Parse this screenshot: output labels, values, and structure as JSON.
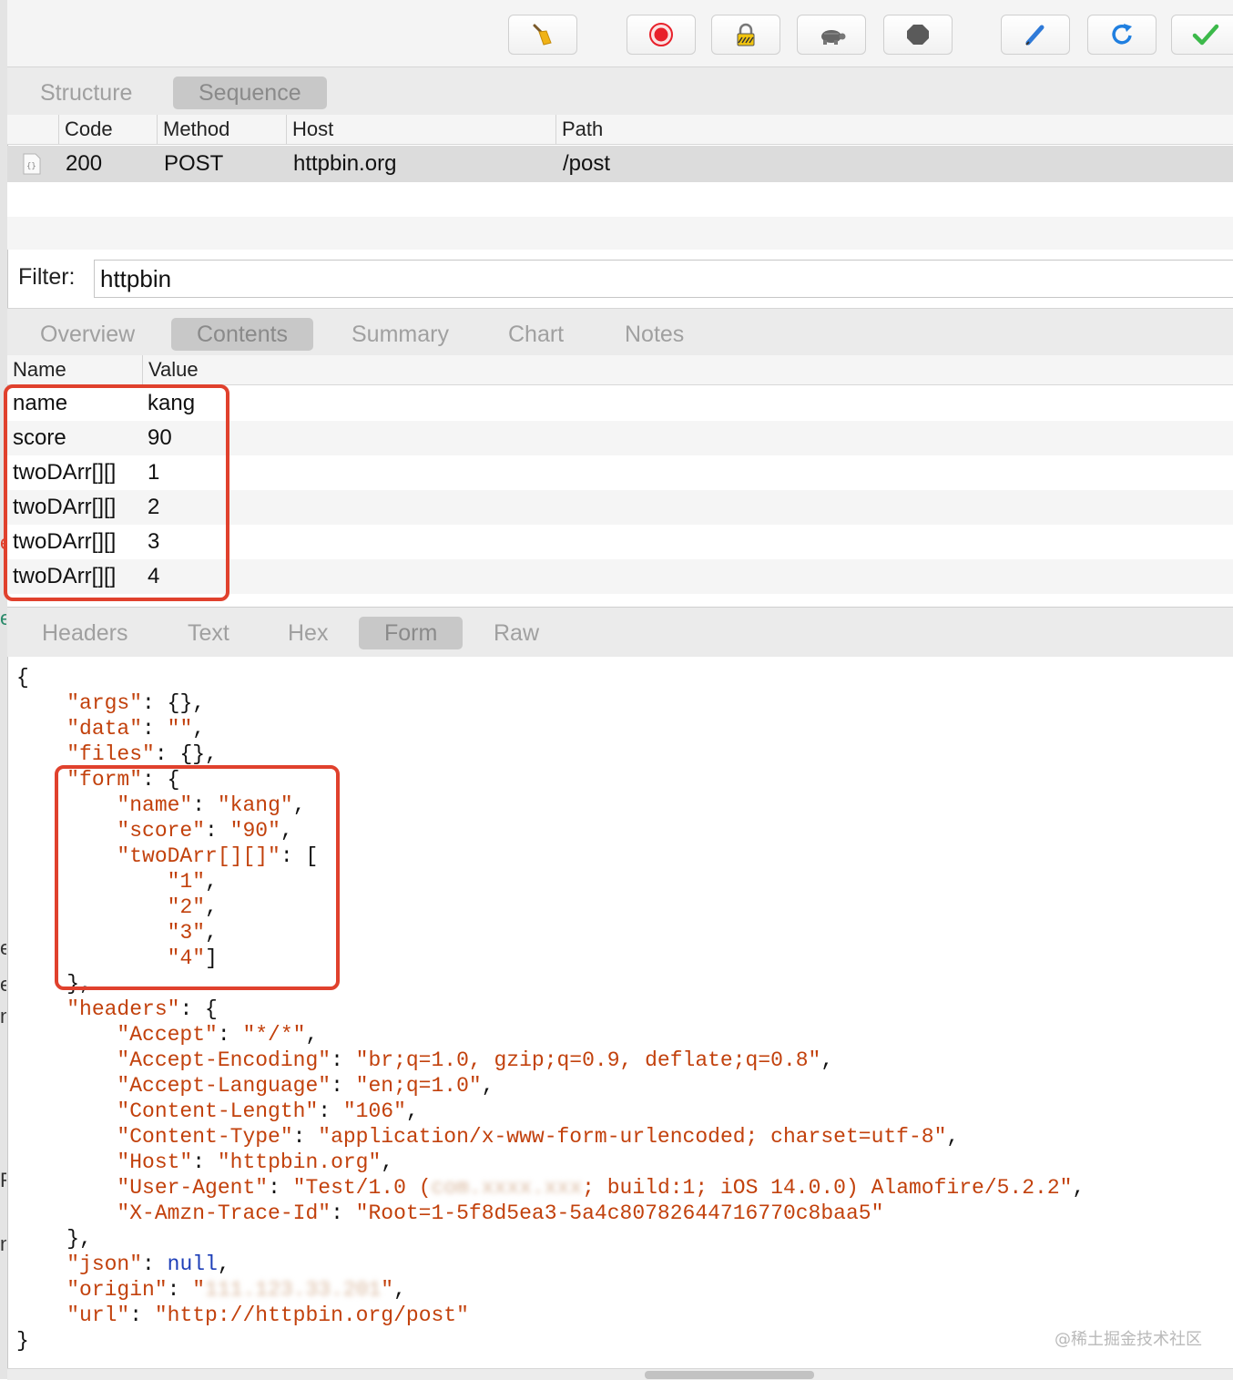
{
  "toolbar": {
    "buttons": [
      {
        "icon": "broom-icon"
      },
      {
        "icon": "record-icon"
      },
      {
        "icon": "lock-icon"
      },
      {
        "icon": "turtle-icon"
      },
      {
        "icon": "stop-icon"
      },
      {
        "icon": "pen-icon"
      },
      {
        "icon": "refresh-icon"
      },
      {
        "icon": "checkmark-icon"
      }
    ],
    "colors": {
      "record": "#e8202a",
      "refresh": "#1f7fe0",
      "check": "#3cb94a",
      "pen": "#2f7ad8",
      "broom": "#f0b216"
    }
  },
  "view_tabs": [
    {
      "label": "Structure",
      "active": false
    },
    {
      "label": "Sequence",
      "active": true
    }
  ],
  "request_table": {
    "columns": [
      "Code",
      "Method",
      "Host",
      "Path"
    ],
    "rows": [
      {
        "code": "200",
        "method": "POST",
        "host": "httpbin.org",
        "path": "/post"
      }
    ]
  },
  "filter": {
    "label": "Filter:",
    "value": "httpbin"
  },
  "detail_tabs": [
    {
      "label": "Overview",
      "active": false
    },
    {
      "label": "Contents",
      "active": true
    },
    {
      "label": "Summary",
      "active": false
    },
    {
      "label": "Chart",
      "active": false
    },
    {
      "label": "Notes",
      "active": false
    }
  ],
  "params_table": {
    "columns": [
      "Name",
      "Value"
    ],
    "rows": [
      {
        "name": "name",
        "value": "kang"
      },
      {
        "name": "score",
        "value": "90"
      },
      {
        "name": "twoDArr[][]",
        "value": "1"
      },
      {
        "name": "twoDArr[][]",
        "value": "2"
      },
      {
        "name": "twoDArr[][]",
        "value": "3"
      },
      {
        "name": "twoDArr[][]",
        "value": "4"
      }
    ]
  },
  "body_tabs": [
    {
      "label": "Headers",
      "active": false
    },
    {
      "label": "Text",
      "active": false
    },
    {
      "label": "Hex",
      "active": false
    },
    {
      "label": "Form",
      "active": true
    },
    {
      "label": "Raw",
      "active": false
    }
  ],
  "json_lines": [
    [
      {
        "t": "p",
        "v": "{"
      }
    ],
    [
      {
        "t": "p",
        "v": "    "
      },
      {
        "t": "k",
        "v": "\"args\""
      },
      {
        "t": "p",
        "v": ": {},"
      }
    ],
    [
      {
        "t": "p",
        "v": "    "
      },
      {
        "t": "k",
        "v": "\"data\""
      },
      {
        "t": "p",
        "v": ": "
      },
      {
        "t": "s",
        "v": "\"\""
      },
      {
        "t": "p",
        "v": ","
      }
    ],
    [
      {
        "t": "p",
        "v": "    "
      },
      {
        "t": "k",
        "v": "\"files\""
      },
      {
        "t": "p",
        "v": ": {},"
      }
    ],
    [
      {
        "t": "p",
        "v": "    "
      },
      {
        "t": "k",
        "v": "\"form\""
      },
      {
        "t": "p",
        "v": ": {"
      }
    ],
    [
      {
        "t": "p",
        "v": "        "
      },
      {
        "t": "k",
        "v": "\"name\""
      },
      {
        "t": "p",
        "v": ": "
      },
      {
        "t": "s",
        "v": "\"kang\""
      },
      {
        "t": "p",
        "v": ","
      }
    ],
    [
      {
        "t": "p",
        "v": "        "
      },
      {
        "t": "k",
        "v": "\"score\""
      },
      {
        "t": "p",
        "v": ": "
      },
      {
        "t": "s",
        "v": "\"90\""
      },
      {
        "t": "p",
        "v": ","
      }
    ],
    [
      {
        "t": "p",
        "v": "        "
      },
      {
        "t": "k",
        "v": "\"twoDArr[][]\""
      },
      {
        "t": "p",
        "v": ": ["
      }
    ],
    [
      {
        "t": "p",
        "v": "            "
      },
      {
        "t": "s",
        "v": "\"1\""
      },
      {
        "t": "p",
        "v": ","
      }
    ],
    [
      {
        "t": "p",
        "v": "            "
      },
      {
        "t": "s",
        "v": "\"2\""
      },
      {
        "t": "p",
        "v": ","
      }
    ],
    [
      {
        "t": "p",
        "v": "            "
      },
      {
        "t": "s",
        "v": "\"3\""
      },
      {
        "t": "p",
        "v": ","
      }
    ],
    [
      {
        "t": "p",
        "v": "            "
      },
      {
        "t": "s",
        "v": "\"4\""
      },
      {
        "t": "p",
        "v": "]"
      }
    ],
    [
      {
        "t": "p",
        "v": "    },"
      }
    ],
    [
      {
        "t": "p",
        "v": "    "
      },
      {
        "t": "k",
        "v": "\"headers\""
      },
      {
        "t": "p",
        "v": ": {"
      }
    ],
    [
      {
        "t": "p",
        "v": "        "
      },
      {
        "t": "k",
        "v": "\"Accept\""
      },
      {
        "t": "p",
        "v": ": "
      },
      {
        "t": "s",
        "v": "\"*/*\""
      },
      {
        "t": "p",
        "v": ","
      }
    ],
    [
      {
        "t": "p",
        "v": "        "
      },
      {
        "t": "k",
        "v": "\"Accept-Encoding\""
      },
      {
        "t": "p",
        "v": ": "
      },
      {
        "t": "s",
        "v": "\"br;q=1.0, gzip;q=0.9, deflate;q=0.8\""
      },
      {
        "t": "p",
        "v": ","
      }
    ],
    [
      {
        "t": "p",
        "v": "        "
      },
      {
        "t": "k",
        "v": "\"Accept-Language\""
      },
      {
        "t": "p",
        "v": ": "
      },
      {
        "t": "s",
        "v": "\"en;q=1.0\""
      },
      {
        "t": "p",
        "v": ","
      }
    ],
    [
      {
        "t": "p",
        "v": "        "
      },
      {
        "t": "k",
        "v": "\"Content-Length\""
      },
      {
        "t": "p",
        "v": ": "
      },
      {
        "t": "s",
        "v": "\"106\""
      },
      {
        "t": "p",
        "v": ","
      }
    ],
    [
      {
        "t": "p",
        "v": "        "
      },
      {
        "t": "k",
        "v": "\"Content-Type\""
      },
      {
        "t": "p",
        "v": ": "
      },
      {
        "t": "s",
        "v": "\"application/x-www-form-urlencoded; charset=utf-8\""
      },
      {
        "t": "p",
        "v": ","
      }
    ],
    [
      {
        "t": "p",
        "v": "        "
      },
      {
        "t": "k",
        "v": "\"Host\""
      },
      {
        "t": "p",
        "v": ": "
      },
      {
        "t": "s",
        "v": "\"httpbin.org\""
      },
      {
        "t": "p",
        "v": ","
      }
    ],
    [
      {
        "t": "p",
        "v": "        "
      },
      {
        "t": "k",
        "v": "\"User-Agent\""
      },
      {
        "t": "p",
        "v": ": "
      },
      {
        "t": "s",
        "v": "\"Test/1.0 ("
      },
      {
        "t": "blur",
        "v": "com.xxxx.xxx"
      },
      {
        "t": "s",
        "v": "; build:1; iOS 14.0.0) Alamofire/5.2.2\""
      },
      {
        "t": "p",
        "v": ","
      }
    ],
    [
      {
        "t": "p",
        "v": "        "
      },
      {
        "t": "k",
        "v": "\"X-Amzn-Trace-Id\""
      },
      {
        "t": "p",
        "v": ": "
      },
      {
        "t": "s",
        "v": "\"Root=1-5f8d5ea3-5a4c80782644716770c8baa5\""
      }
    ],
    [
      {
        "t": "p",
        "v": "    },"
      }
    ],
    [
      {
        "t": "p",
        "v": "    "
      },
      {
        "t": "k",
        "v": "\"json\""
      },
      {
        "t": "p",
        "v": ": "
      },
      {
        "t": "kw",
        "v": "null"
      },
      {
        "t": "p",
        "v": ","
      }
    ],
    [
      {
        "t": "p",
        "v": "    "
      },
      {
        "t": "k",
        "v": "\"origin\""
      },
      {
        "t": "p",
        "v": ": "
      },
      {
        "t": "s",
        "v": "\""
      },
      {
        "t": "blur",
        "v": "111.123.33.201"
      },
      {
        "t": "s",
        "v": "\""
      },
      {
        "t": "p",
        "v": ","
      }
    ],
    [
      {
        "t": "p",
        "v": "    "
      },
      {
        "t": "k",
        "v": "\"url\""
      },
      {
        "t": "p",
        "v": ": "
      },
      {
        "t": "s",
        "v": "\"http://httpbin.org/post\""
      }
    ],
    [
      {
        "t": "p",
        "v": "}"
      }
    ]
  ],
  "watermark": "@稀土掘金技术社区"
}
